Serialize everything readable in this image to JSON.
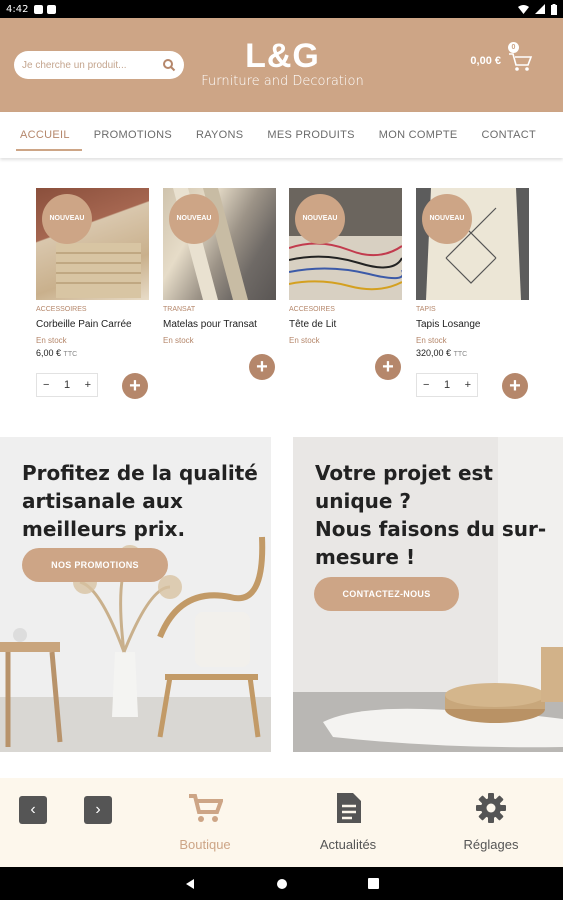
{
  "status_bar": {
    "time": "4:42"
  },
  "header": {
    "search_placeholder": "Je cherche un produit...",
    "logo_title": "L&G",
    "logo_subtitle": "Furniture and Decoration",
    "cart_total": "0,00 €",
    "cart_count": "0"
  },
  "tabs": [
    {
      "label": "ACCUEIL",
      "active": true
    },
    {
      "label": "PROMOTIONS"
    },
    {
      "label": "RAYONS"
    },
    {
      "label": "MES PRODUITS"
    },
    {
      "label": "MON COMPTE"
    },
    {
      "label": "CONTACT"
    }
  ],
  "products": [
    {
      "badge": "NOUVEAU",
      "category": "ACCESSOIRES",
      "name": "Corbeille Pain Carrée",
      "stock": "En stock",
      "price": "6,00 €",
      "ttc": "TTC",
      "qty": "1",
      "qty_minus": "−",
      "qty_plus": "+",
      "add": "+"
    },
    {
      "badge": "NOUVEAU",
      "category": "TRANSAT",
      "name": "Matelas pour Transat",
      "stock": "En stock",
      "add": "+"
    },
    {
      "badge": "NOUVEAU",
      "category": "ACCESOIRES",
      "name": "Tête de Lit",
      "stock": "En stock",
      "add": "+"
    },
    {
      "badge": "NOUVEAU",
      "category": "TAPIS",
      "name": "Tapis Losange",
      "stock": "En stock",
      "price": "320,00 €",
      "ttc": "TTC",
      "qty": "1",
      "qty_minus": "−",
      "qty_plus": "+",
      "add": "+"
    }
  ],
  "banners": {
    "left": {
      "line1": "Profitez de la qualité",
      "line2": "artisanale aux",
      "line3": "meilleurs prix.",
      "button": "NOS PROMOTIONS"
    },
    "right": {
      "line1": "Votre projet est",
      "line2": "unique ?",
      "line3": "Nous faisons du sur-",
      "line4": "mesure !",
      "button": "CONTACTEZ-NOUS"
    }
  },
  "bottom_nav": {
    "back": "‹",
    "forward": "›",
    "items": [
      {
        "label": "Boutique",
        "icon": "cart-icon",
        "active": true
      },
      {
        "label": "Actualités",
        "icon": "document-icon"
      },
      {
        "label": "Réglages",
        "icon": "gear-icon"
      }
    ]
  },
  "colors": {
    "brand": "#cda586",
    "accent": "#b5876b",
    "nav_bg": "#fdf7ec"
  }
}
